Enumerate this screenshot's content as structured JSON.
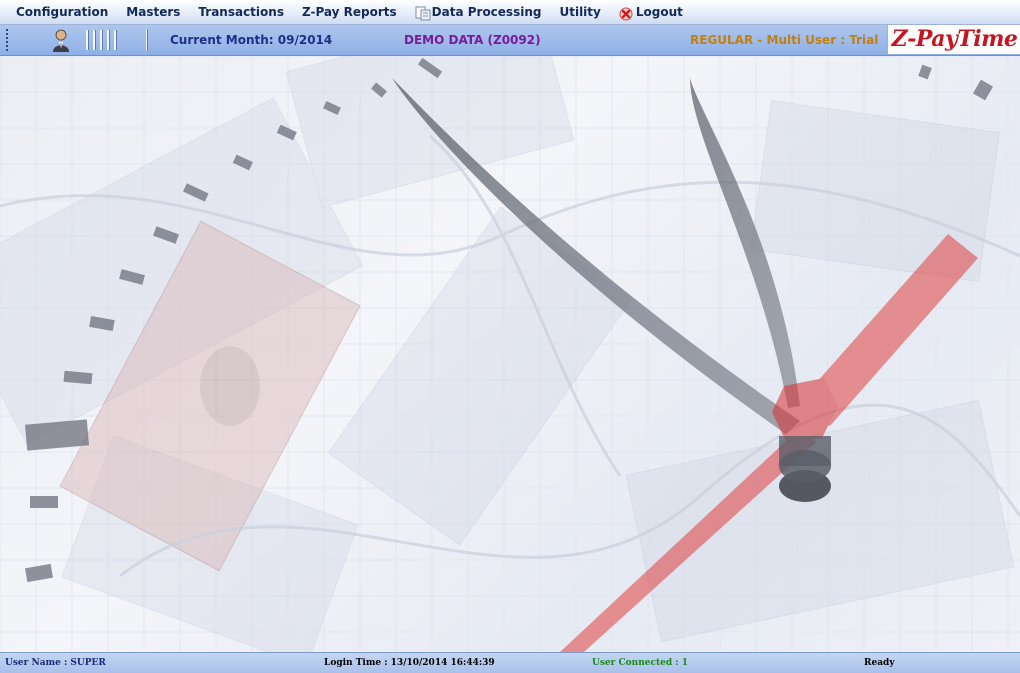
{
  "menu": {
    "items": [
      {
        "label": "Configuration"
      },
      {
        "label": "Masters"
      },
      {
        "label": "Transactions"
      },
      {
        "label": "Z-Pay Reports"
      },
      {
        "label": "Data Processing",
        "icon": "data-processing-icon"
      },
      {
        "label": "Utility"
      },
      {
        "label": "Logout",
        "icon": "logout-x-icon"
      }
    ]
  },
  "infobar": {
    "current_month": "Current Month: 09/2014",
    "demo_data": "DEMO DATA (Z0092)",
    "license": "REGULAR - Multi User : Trial",
    "brand": "Z-PayTime"
  },
  "status": {
    "user": "User Name : SUPER",
    "login_time": "Login Time : 13/10/2014 16:44:39",
    "connected": "User Connected : 1",
    "state": "Ready"
  },
  "colors": {
    "brand": "#c8141e",
    "month_text": "#1f2f8a",
    "demo_text": "#7a1a9a",
    "license_text": "#c47f0a",
    "connected_text": "#1a8a1a"
  }
}
